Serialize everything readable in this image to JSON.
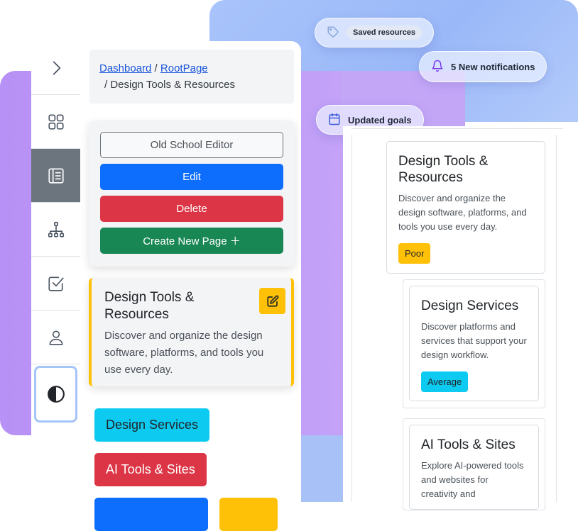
{
  "notifications": {
    "saved": {
      "label": "Saved resources",
      "icon": "tag-icon"
    },
    "new": {
      "label": "5 New notifications",
      "icon": "bell-icon"
    },
    "goals": {
      "label": "Updated goals",
      "icon": "calendar-icon"
    }
  },
  "sidebar": {
    "items": [
      {
        "name": "expand",
        "icon": "chevron-right-icon"
      },
      {
        "name": "dashboard",
        "icon": "grid-icon"
      },
      {
        "name": "pages",
        "icon": "list-panel-icon",
        "active": true
      },
      {
        "name": "sitemap",
        "icon": "hierarchy-icon"
      },
      {
        "name": "tasks",
        "icon": "checkbox-icon"
      },
      {
        "name": "profile",
        "icon": "user-icon"
      },
      {
        "name": "theme",
        "icon": "contrast-icon"
      }
    ]
  },
  "breadcrumb": {
    "link1": "Dashboard",
    "sep1": " / ",
    "link2": "RootPage",
    "current": "/ Design Tools & Resources"
  },
  "actions": {
    "old_editor": "Old School Editor",
    "edit": "Edit",
    "delete": "Delete",
    "create": "Create New Page ＋"
  },
  "current_page": {
    "title": "Design Tools & Resources",
    "description": "Discover and organize the design software, platforms, and tools you use every day."
  },
  "children": {
    "design_services": "Design Services",
    "ai_tools": "AI Tools & Sites"
  },
  "tree": {
    "root": {
      "title": "Design Tools & Resources",
      "description": "Discover and organize the design software, platforms, and tools you use every day.",
      "badge": "Poor"
    },
    "child1": {
      "title": "Design Services",
      "description": "Discover platforms and services that support your design workflow.",
      "badge": "Average"
    },
    "child2": {
      "title": "AI Tools & Sites",
      "description": "Explore AI-powered tools and websites for creativity and"
    }
  },
  "colors": {
    "primary": "#0d6efd",
    "danger": "#dc3545",
    "success": "#198754",
    "warning": "#ffc107",
    "info": "#0dcaf0"
  }
}
